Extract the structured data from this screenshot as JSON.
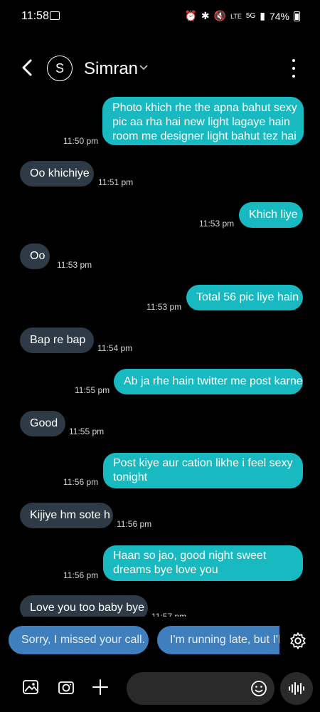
{
  "status": {
    "time": "11:58",
    "network": "5G",
    "lte": "LTE",
    "battery": "74%"
  },
  "header": {
    "avatar_initial": "S",
    "contact_name": "Simran"
  },
  "messages": [
    {
      "dir": "out",
      "text": [
        "Photo khich rhe the apna bahut sexy",
        "pic aa rha hai new light lagaye hain",
        "room me designer light bahut tez hai"
      ],
      "time": "11:50 pm"
    },
    {
      "dir": "in",
      "text": [
        "Oo khichiye"
      ],
      "time": "11:51 pm"
    },
    {
      "dir": "out",
      "text": [
        "Khich liye"
      ],
      "time": "11:53 pm"
    },
    {
      "dir": "in",
      "text": [
        "Oo"
      ],
      "time": "11:53 pm"
    },
    {
      "dir": "out",
      "text": [
        "Total 56 pic liye hain"
      ],
      "time": "11:53 pm"
    },
    {
      "dir": "in",
      "text": [
        "Bap re bap"
      ],
      "time": "11:54 pm"
    },
    {
      "dir": "out",
      "text": [
        "Ab ja rhe hain twitter me post karne"
      ],
      "time": "11:55 pm"
    },
    {
      "dir": "in",
      "text": [
        "Good"
      ],
      "time": "11:55 pm"
    },
    {
      "dir": "out",
      "text": [
        "Post kiye aur cation likhe i feel sexy",
        "tonight"
      ],
      "time": "11:56 pm"
    },
    {
      "dir": "in",
      "text": [
        "Kijiye hm sote h"
      ],
      "time": "11:56 pm"
    },
    {
      "dir": "out",
      "text": [
        "Haan so jao, good night sweet",
        "dreams bye love you"
      ],
      "time": "11:56 pm"
    },
    {
      "dir": "in",
      "text": [
        "Love you too baby bye"
      ],
      "time": "11:57 pm"
    }
  ],
  "suggestions": [
    "Sorry, I missed your call.",
    "I'm running late, but I'll"
  ],
  "colors": {
    "incoming": "#2e3a45",
    "outgoing": "#19b9c1",
    "chip": "#3f7fbd",
    "background": "#000000"
  }
}
